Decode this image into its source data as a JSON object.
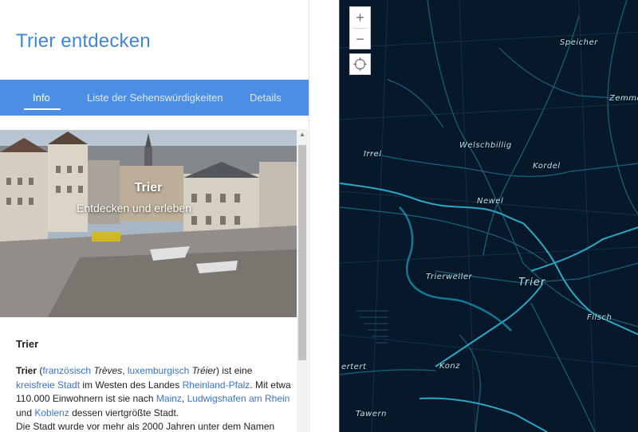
{
  "app": {
    "title": "Trier entdecken"
  },
  "tabs": [
    {
      "label": "Info",
      "active": true
    },
    {
      "label": "Liste der Sehenswürdigkeiten",
      "active": false
    },
    {
      "label": "Details",
      "active": false
    }
  ],
  "hero": {
    "title": "Trier",
    "subtitle": "Entdecken und erleben"
  },
  "article": {
    "heading": "Trier",
    "segments": [
      {
        "t": "Trier",
        "style": "bold"
      },
      {
        "t": " (",
        "style": "plain"
      },
      {
        "t": "französisch",
        "style": "link"
      },
      {
        "t": " ",
        "style": "plain"
      },
      {
        "t": "Trèves",
        "style": "italic"
      },
      {
        "t": ", ",
        "style": "plain"
      },
      {
        "t": "luxemburgisch",
        "style": "link"
      },
      {
        "t": " ",
        "style": "plain"
      },
      {
        "t": "Tréier",
        "style": "italic"
      },
      {
        "t": ") ist eine ",
        "style": "plain"
      },
      {
        "t": "kreisfreie Stadt",
        "style": "link"
      },
      {
        "t": " im Westen des Landes ",
        "style": "plain"
      },
      {
        "t": "Rheinland-Pfalz",
        "style": "link"
      },
      {
        "t": ". Mit etwa 110.000 Einwohnern ist sie nach ",
        "style": "plain"
      },
      {
        "t": "Mainz",
        "style": "link"
      },
      {
        "t": ", ",
        "style": "plain"
      },
      {
        "t": "Ludwigshafen am Rhein",
        "style": "link"
      },
      {
        "t": " und ",
        "style": "plain"
      },
      {
        "t": "Koblenz",
        "style": "link"
      },
      {
        "t": " dessen viertgrößte Stadt.",
        "style": "plain"
      },
      {
        "t": "Die Stadt wurde vor mehr als 2000 Jahren unter dem Namen",
        "style": "newline"
      }
    ]
  },
  "map": {
    "zoom_in": "+",
    "zoom_out": "−",
    "background": "#07182a",
    "road_color": "#2aa7c4",
    "labels": [
      {
        "text": "Speicher",
        "size": "normal"
      },
      {
        "text": "Zemmer",
        "size": "normal"
      },
      {
        "text": "Welschbillig",
        "size": "normal"
      },
      {
        "text": "Kordel",
        "size": "normal"
      },
      {
        "text": "Irrel",
        "size": "normal"
      },
      {
        "text": "Newel",
        "size": "normal"
      },
      {
        "text": "Trierweiler",
        "size": "normal"
      },
      {
        "text": "Trier",
        "size": "big"
      },
      {
        "text": "Filsch",
        "size": "normal"
      },
      {
        "text": "Konz",
        "size": "normal"
      },
      {
        "text": "Tawern",
        "size": "normal"
      },
      {
        "text": "ertert",
        "size": "normal"
      }
    ]
  }
}
